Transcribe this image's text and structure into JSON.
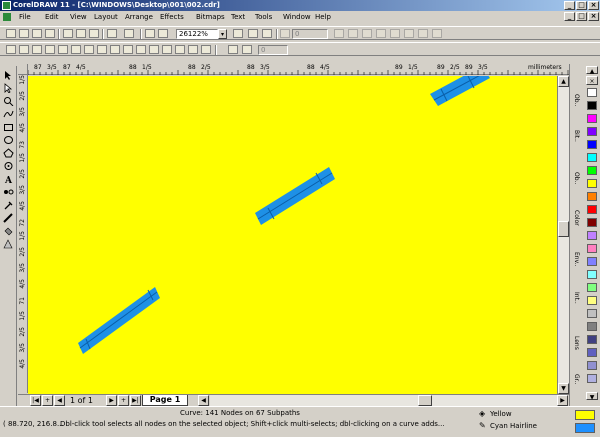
{
  "window": {
    "title": "CorelDRAW 11 - [C:\\WINDOWS\\Desktop\\001\\002.cdr]"
  },
  "menu": [
    "File",
    "Edit",
    "View",
    "Layout",
    "Arrange",
    "Effects",
    "Bitmaps",
    "Text",
    "Tools",
    "Window",
    "Help"
  ],
  "toolbar": {
    "zoom": "26122%",
    "field_a": "0",
    "field_b": "0",
    "field_c": "0"
  },
  "ruler": {
    "unit": "millimeters",
    "h_labels": [
      "87",
      "3/5",
      "87",
      "4/5",
      "88",
      "1/5",
      "88",
      "2/5",
      "88",
      "3/5",
      "88",
      "4/5",
      "89",
      "1/5",
      "89",
      "2/5",
      "89",
      "3/5"
    ],
    "v_labels": [
      "1/5",
      "2/5",
      "3/5",
      "4/5",
      "73",
      "1/5",
      "2/5",
      "3/5",
      "4/5",
      "72",
      "1/5",
      "2/5",
      "3/5",
      "4/5",
      "71",
      "1/5",
      "2/5",
      "3/5",
      "4/5"
    ]
  },
  "pages": {
    "current": "1 of 1",
    "tab": "Page 1"
  },
  "dockers": [
    "Ob..",
    "Bit..",
    "Ob..",
    "Color",
    "Env..",
    "Int..",
    "Lens",
    "Gr.."
  ],
  "palette": [
    "#ffffff",
    "#000000",
    "#ff00ff",
    "#8000ff",
    "#0000ff",
    "#00ffff",
    "#00ff00",
    "#ffff00",
    "#ff8000",
    "#ff0000",
    "#800000",
    "#c080ff",
    "#ff80c0",
    "#8080ff",
    "#80ffff",
    "#80ff80",
    "#ffff80",
    "#c0c0c0",
    "#808080",
    "#404080",
    "#6060c0",
    "#9090d0",
    "#b0b0e0"
  ],
  "status": {
    "object": "Curve: 141 Nodes on 67 Subpaths",
    "coords": "( 88.720, 216.8...",
    "hint": "Dbl-click tool selects all nodes on the selected object; Shift+click multi-selects; dbl-clicking on a curve adds...",
    "fill_label": "Yellow",
    "outline_label": "Cyan  Hairline",
    "fill_color": "#ffff00",
    "outline_color": "#1e90ff"
  }
}
